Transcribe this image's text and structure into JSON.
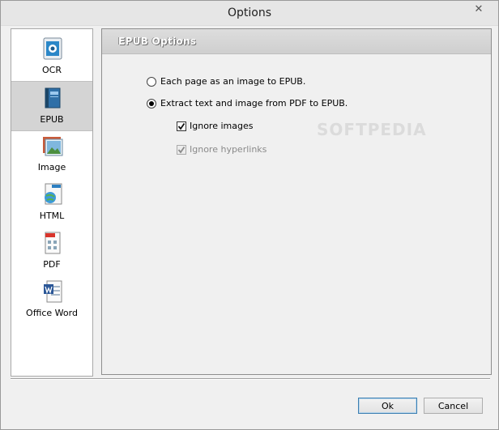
{
  "window": {
    "title": "Options",
    "close_glyph": "✕"
  },
  "sidebar": {
    "items": [
      {
        "label": "OCR",
        "icon": "ocr-icon"
      },
      {
        "label": "EPUB",
        "icon": "epub-book-icon",
        "selected": true
      },
      {
        "label": "Image",
        "icon": "image-icon"
      },
      {
        "label": "HTML",
        "icon": "html-globe-icon"
      },
      {
        "label": "PDF",
        "icon": "pdf-icon"
      },
      {
        "label": "Office Word",
        "icon": "word-document-icon"
      }
    ]
  },
  "panel": {
    "title": "EPUB Options",
    "radio_image": {
      "label": "Each page as an image to EPUB.",
      "checked": false
    },
    "radio_extract": {
      "label": "Extract text and image from PDF to EPUB.",
      "checked": true
    },
    "check_ignore_images": {
      "label": "Ignore images",
      "checked": true
    },
    "check_ignore_hyperlinks": {
      "label": "Ignore hyperlinks",
      "checked": true,
      "disabled": true
    },
    "watermark": "SOFTPEDIA"
  },
  "buttons": {
    "ok": "Ok",
    "cancel": "Cancel"
  },
  "colors": {
    "selected_bg": "#d4d4d4",
    "default_button_border": "#3c7fb1"
  }
}
